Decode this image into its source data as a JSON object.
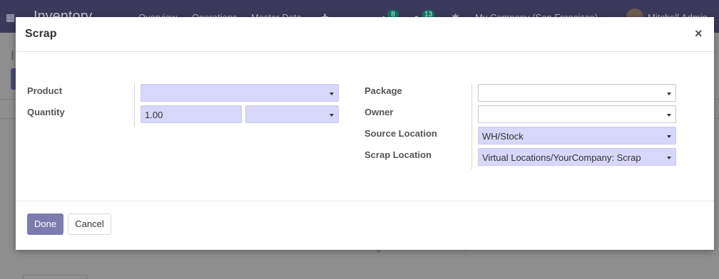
{
  "background": {
    "app_title": "Inventory",
    "menu": [
      "Overview",
      "Operations",
      "Master Data"
    ],
    "activity_count": "8",
    "message_count": "13",
    "company": "My Company (San Francisco)",
    "user": "Mitchell Admin"
  },
  "dialog": {
    "title": "Scrap",
    "close_glyph": "×",
    "left": {
      "product_label": "Product",
      "product_value": "",
      "quantity_label": "Quantity",
      "quantity_value": "1.00",
      "uom_value": ""
    },
    "right": {
      "package_label": "Package",
      "package_value": "",
      "owner_label": "Owner",
      "owner_value": "",
      "source_location_label": "Source Location",
      "source_location_value": "WH/Stock",
      "scrap_location_label": "Scrap Location",
      "scrap_location_value": "Virtual Locations/YourCompany: Scrap"
    },
    "footer": {
      "done_label": "Done",
      "cancel_label": "Cancel"
    }
  },
  "colors": {
    "required_field_bg": "#d7d6fb",
    "primary_button": "#7c7bad",
    "navbar": "#3c3a5a"
  }
}
